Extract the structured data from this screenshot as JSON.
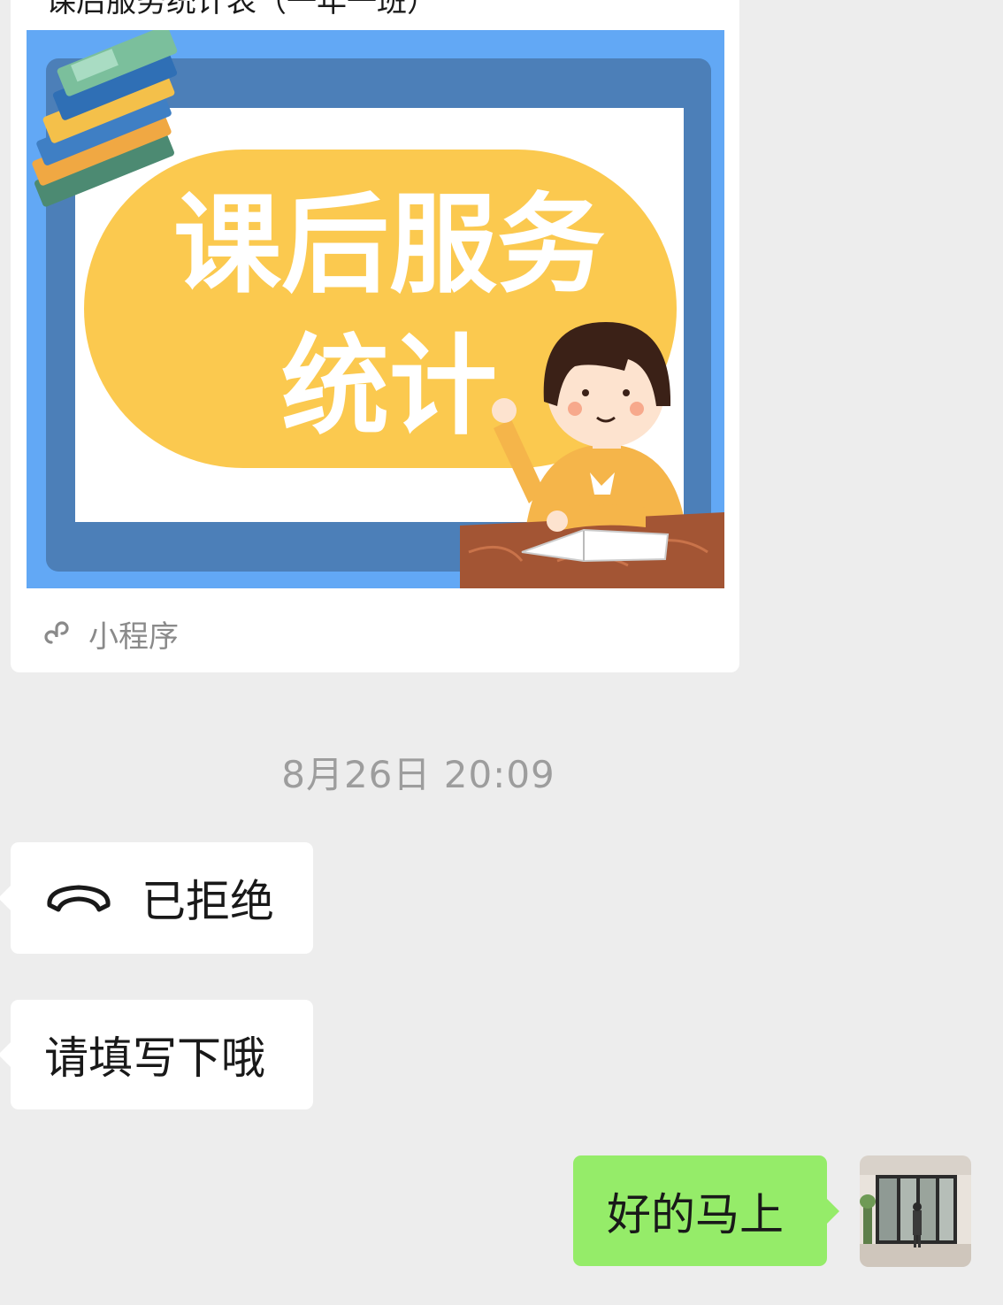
{
  "mini_program": {
    "title": "课后服务统计表（一年一班）",
    "cover_text_line1": "课后服务",
    "cover_text_line2": "统计",
    "source_label": "小程序"
  },
  "timestamp": "8月26日 20:09",
  "messages": [
    {
      "from": "other",
      "type": "call",
      "text": "已拒绝",
      "icon": "phone-hangup-icon"
    },
    {
      "from": "other",
      "type": "text",
      "text": "请填写下哦"
    },
    {
      "from": "me",
      "type": "text",
      "text": "好的马上"
    }
  ],
  "colors": {
    "background": "#ededed",
    "bubble_other": "#ffffff",
    "bubble_me": "#95ec69",
    "cover_blue": "#62a8f5",
    "cover_yellow": "#fbc94f"
  }
}
